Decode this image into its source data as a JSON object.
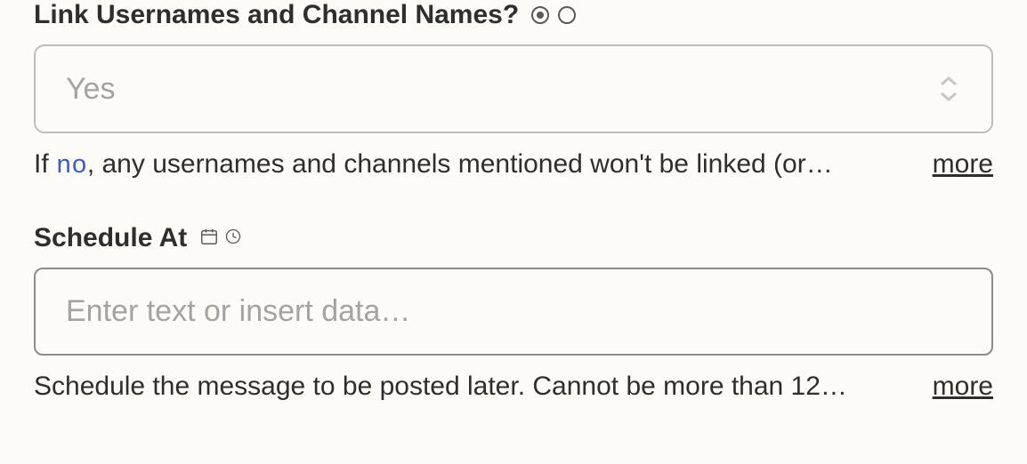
{
  "linkNames": {
    "label": "Link Usernames and Channel Names?",
    "value": "Yes",
    "helpPrefix": "If ",
    "helpCode": "no",
    "helpSuffix": ", any usernames and channels mentioned won't be linked (or…",
    "more": "more"
  },
  "scheduleAt": {
    "label": "Schedule At",
    "placeholder": "Enter text or insert data…",
    "help": "Schedule the message to be posted later. Cannot be more than 12…",
    "more": "more"
  }
}
